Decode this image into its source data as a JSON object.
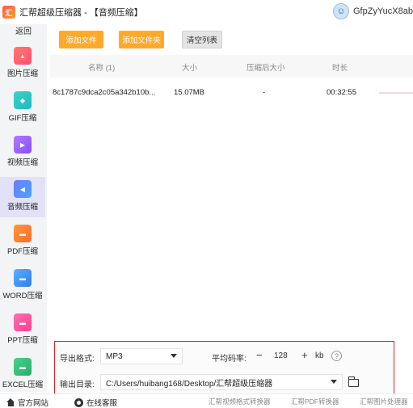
{
  "window": {
    "app_name": "汇帮超级压缩器",
    "module_title": "- 【音频压缩】",
    "username": "GfpZyYucX8ab"
  },
  "sidebar": {
    "back_label": "返回",
    "items": [
      {
        "label": "图片压缩",
        "icon": "image-icon"
      },
      {
        "label": "GIF压缩",
        "icon": "gif-icon"
      },
      {
        "label": "视频压缩",
        "icon": "video-icon"
      },
      {
        "label": "音频压缩",
        "icon": "audio-icon",
        "active": true
      },
      {
        "label": "PDF压缩",
        "icon": "pdf-icon"
      },
      {
        "label": "WORD压缩",
        "icon": "word-icon"
      },
      {
        "label": "PPT压缩",
        "icon": "ppt-icon"
      },
      {
        "label": "EXCEL压缩",
        "icon": "excel-icon"
      }
    ]
  },
  "toolbar": {
    "add_file": "添加文件",
    "add_folder": "添加文件夹",
    "clear_list": "清空列表"
  },
  "table": {
    "columns": [
      "名称 (1)",
      "大小",
      "压缩后大小",
      "时长"
    ],
    "rows": [
      {
        "name": "8c1787c9dca2c05a342b10b...",
        "size": "15.07MB",
        "compressed_size": "-",
        "duration": "00:32:55",
        "progress": 0
      }
    ]
  },
  "settings": {
    "format_label": "导出格式:",
    "format_value": "MP3",
    "bitrate_label": "平均码率:",
    "bitrate_minus": "−",
    "bitrate_value": "128",
    "bitrate_plus": "+",
    "bitrate_unit": "kb",
    "help_symbol": "?",
    "output_label": "输出目录:",
    "output_path": "C:/Users/huibang168/Desktop/汇帮超级压缩器"
  },
  "footer": {
    "official_site": "官方网站",
    "online_support": "在线客服",
    "links": [
      "汇帮视频格式转换器",
      "汇帮PDF转换器",
      "汇帮图片处理器"
    ]
  },
  "colors": {
    "accent_orange": "#ffa92b",
    "active_sidebar": "#e3e1f7",
    "panel_border": "#e02020"
  }
}
